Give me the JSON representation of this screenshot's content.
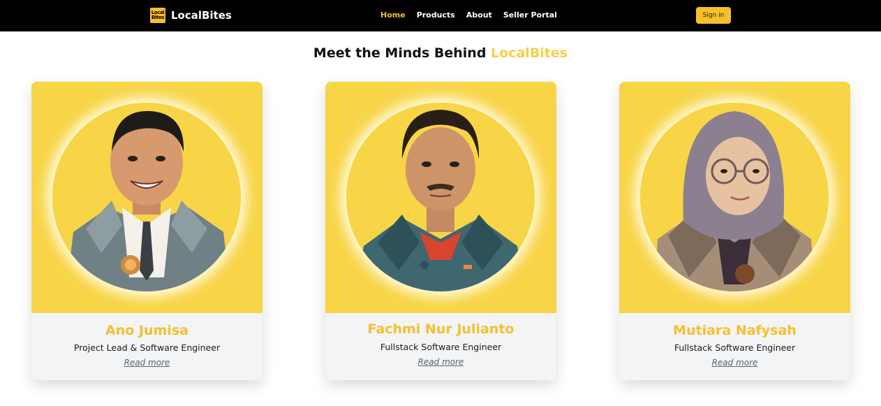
{
  "nav": {
    "brand_logo_line1": "Local",
    "brand_logo_line2": "Bites",
    "brand_name": "LocalBites",
    "links": [
      {
        "label": "Home",
        "active": true
      },
      {
        "label": "Products",
        "active": false
      },
      {
        "label": "About",
        "active": false
      },
      {
        "label": "Seller Portal",
        "active": false
      }
    ],
    "signin_label": "Sign in"
  },
  "section": {
    "title_prefix": "Meet the Minds Behind",
    "title_accent": "LocalBites"
  },
  "team": [
    {
      "name": "Ano Jumisa",
      "role": "Project Lead & Software Engineer",
      "link": "Read more",
      "portrait": "male-avatar-suit-illustration"
    },
    {
      "name": "Fachmi Nur Julianto",
      "role": "Fullstack Software Engineer",
      "link": "Read more",
      "portrait": "male-avatar-jacket-illustration"
    },
    {
      "name": "Mutiara Nafysah",
      "role": "Fullstack Software Engineer",
      "link": "Read more",
      "portrait": "female-avatar-hijab-illustration"
    }
  ],
  "colors": {
    "nav_bg": "#000000",
    "accent": "#f6bf2c",
    "title_accent": "#f7d046",
    "card_photo_bg": "#f8d447",
    "card_bg": "#f3f4f6"
  }
}
